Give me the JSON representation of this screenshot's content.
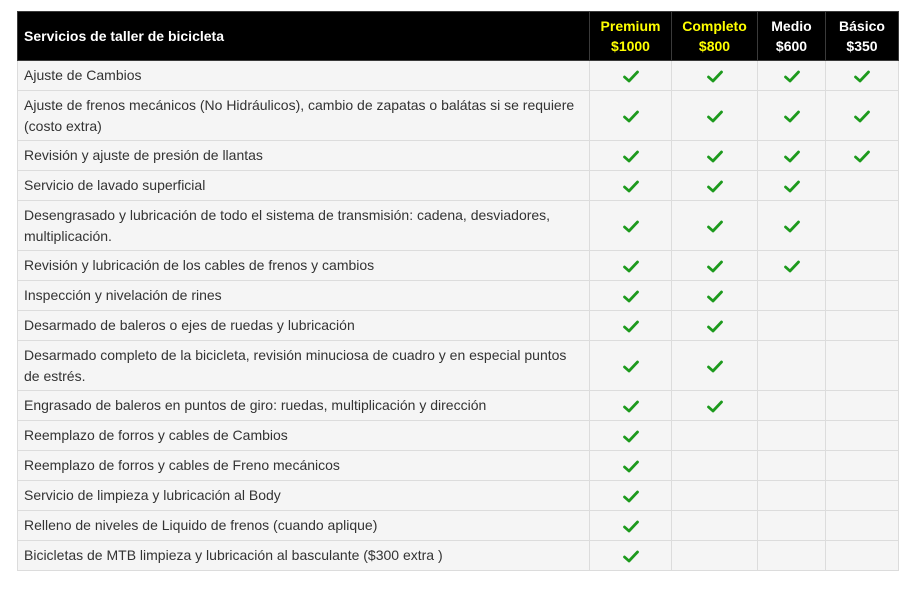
{
  "header": {
    "service_title": "Servicios de taller de bicicleta",
    "plans": [
      {
        "name": "Premium",
        "price": "$1000",
        "highlight": true
      },
      {
        "name": "Completo",
        "price": "$800",
        "highlight": true
      },
      {
        "name": "Medio",
        "price": "$600",
        "highlight": false
      },
      {
        "name": "Básico",
        "price": "$350",
        "highlight": false
      }
    ]
  },
  "colors": {
    "header_bg": "#000000",
    "header_text": "#ffffff",
    "highlight_text": "#ffff00",
    "row_bg": "#f5f5f5",
    "check": "#1d9a1d"
  },
  "check_icon": "checkmark-icon",
  "rows": [
    {
      "service": "Ajuste de Cambios",
      "checks": [
        true,
        true,
        true,
        true
      ]
    },
    {
      "service": "Ajuste de frenos mecánicos (No Hidráulicos), cambio de zapatas o balátas si se requiere (costo extra)",
      "checks": [
        true,
        true,
        true,
        true
      ]
    },
    {
      "service": "Revisión y ajuste de presión de llantas",
      "checks": [
        true,
        true,
        true,
        true
      ]
    },
    {
      "service": "Servicio de lavado superficial",
      "checks": [
        true,
        true,
        true,
        false
      ]
    },
    {
      "service": "Desengrasado y lubricación de todo el sistema de transmisión: cadena, desviadores, multiplicación.",
      "checks": [
        true,
        true,
        true,
        false
      ]
    },
    {
      "service": "Revisión y lubricación de los cables de frenos y cambios",
      "checks": [
        true,
        true,
        true,
        false
      ]
    },
    {
      "service": "Inspección y nivelación de rines",
      "checks": [
        true,
        true,
        false,
        false
      ]
    },
    {
      "service": "Desarmado de baleros o ejes de ruedas y lubricación",
      "checks": [
        true,
        true,
        false,
        false
      ]
    },
    {
      "service": "Desarmado completo de la bicicleta, revisión minuciosa de cuadro y en especial puntos de estrés.",
      "checks": [
        true,
        true,
        false,
        false
      ]
    },
    {
      "service": "Engrasado de baleros en puntos de giro: ruedas, multiplicación y dirección",
      "checks": [
        true,
        true,
        false,
        false
      ]
    },
    {
      "service": "Reemplazo de forros y cables de Cambios",
      "checks": [
        true,
        false,
        false,
        false
      ]
    },
    {
      "service": "Reemplazo de forros y cables de Freno mecánicos",
      "checks": [
        true,
        false,
        false,
        false
      ]
    },
    {
      "service": "Servicio de limpieza y lubricación al Body",
      "checks": [
        true,
        false,
        false,
        false
      ]
    },
    {
      "service": "Relleno de niveles de Liquido de frenos (cuando aplique)",
      "checks": [
        true,
        false,
        false,
        false
      ]
    },
    {
      "service": "Bicicletas de MTB limpieza y lubricación al basculante ($300 extra )",
      "checks": [
        true,
        false,
        false,
        false
      ]
    }
  ]
}
